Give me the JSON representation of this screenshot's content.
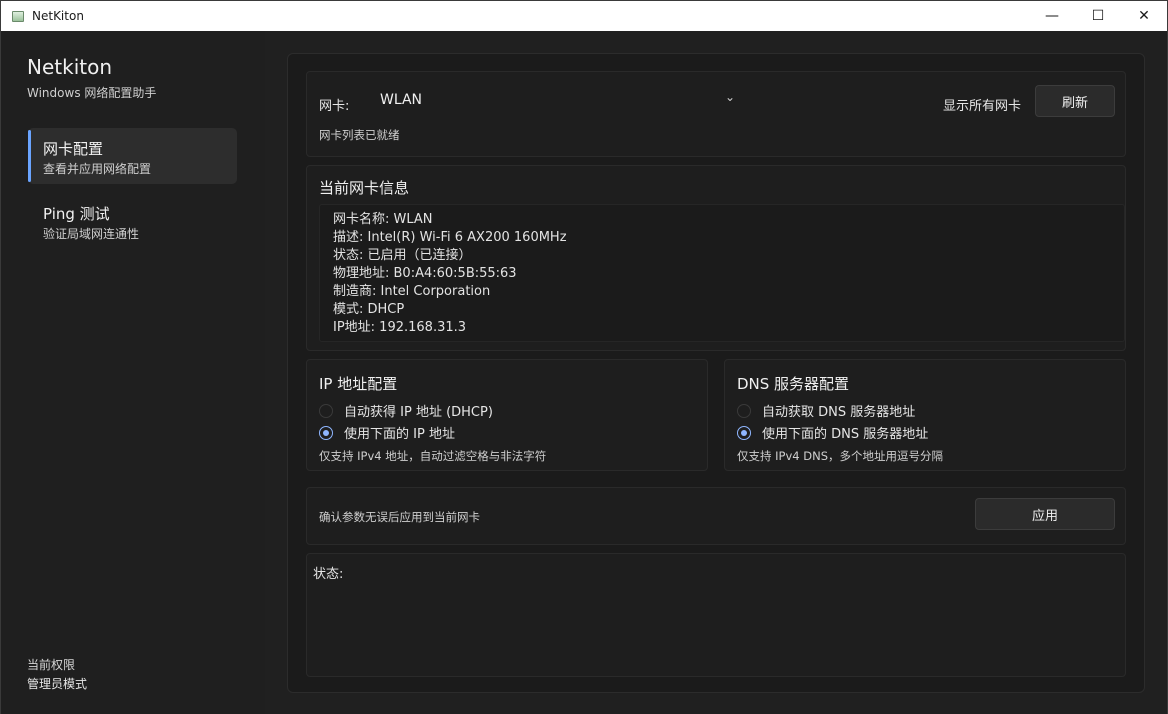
{
  "window": {
    "title": "NetKiton",
    "controls": {
      "minimize": "—",
      "maximize": "☐",
      "close": "✕"
    }
  },
  "sidebar": {
    "app_name": "Netkiton",
    "app_subtitle": "Windows 网络配置助手",
    "nav": [
      {
        "title": "网卡配置",
        "desc": "查看并应用网络配置",
        "active": true
      },
      {
        "title": "Ping 测试",
        "desc": "验证局域网连通性",
        "active": false
      }
    ],
    "permission_label": "当前权限",
    "permission_value": "管理员模式"
  },
  "adapter": {
    "label": "网卡:",
    "selected": "WLAN",
    "show_all_label": "显示所有网卡",
    "refresh_label": "刷新",
    "status_hint": "网卡列表已就绪"
  },
  "info": {
    "title": "当前网卡信息",
    "lines": [
      "网卡名称: WLAN",
      "描述: Intel(R) Wi-Fi 6 AX200 160MHz",
      "状态: 已启用（已连接）",
      "物理地址: B0:A4:60:5B:55:63",
      "制造商: Intel Corporation",
      "模式: DHCP",
      "IP地址: 192.168.31.3"
    ]
  },
  "ip_config": {
    "title": "IP 地址配置",
    "options": [
      {
        "label": "自动获得 IP 地址 (DHCP)",
        "selected": false
      },
      {
        "label": "使用下面的 IP 地址",
        "selected": true
      }
    ],
    "hint": "仅支持 IPv4 地址，自动过滤空格与非法字符"
  },
  "dns_config": {
    "title": "DNS 服务器配置",
    "options": [
      {
        "label": "自动获取 DNS 服务器地址",
        "selected": false
      },
      {
        "label": "使用下面的 DNS 服务器地址",
        "selected": true
      }
    ],
    "hint": "仅支持 IPv4 DNS，多个地址用逗号分隔"
  },
  "apply": {
    "hint": "确认参数无误后应用到当前网卡",
    "button_label": "应用"
  },
  "status": {
    "label": "状态:"
  },
  "colors": {
    "accent": "#8fb6ff",
    "nav_indicator": "#6aa4ff",
    "background": "#1f1f1f"
  }
}
